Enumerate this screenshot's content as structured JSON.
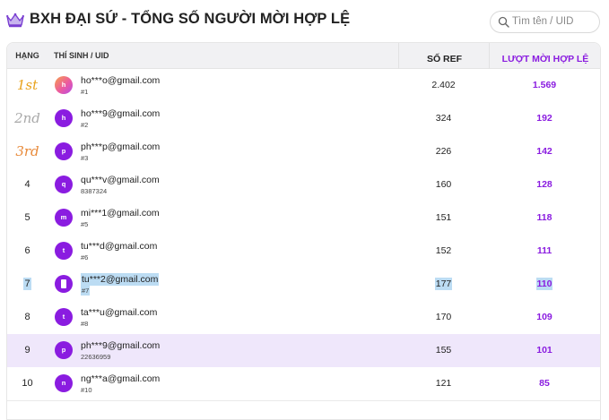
{
  "header": {
    "title": "BXH ĐẠI SỨ - TỔNG SỐ NGƯỜI MỜI HỢP LỆ",
    "icon": "crown-icon"
  },
  "search": {
    "placeholder": "Tìm tên / UID",
    "value": ""
  },
  "table": {
    "columns": {
      "rank": "HẠNG",
      "user": "THÍ SINH / UID",
      "ref": "SỐ REF",
      "valid": "LƯỢT MỜI HỢP LỆ"
    },
    "rows": [
      {
        "rank": "1st",
        "avatar": "h",
        "email": "ho***o@gmail.com",
        "uid": "#1",
        "ref": "2.402",
        "valid": "1.569"
      },
      {
        "rank": "2nd",
        "avatar": "h",
        "email": "ho***9@gmail.com",
        "uid": "#2",
        "ref": "324",
        "valid": "192"
      },
      {
        "rank": "3rd",
        "avatar": "p",
        "email": "ph***p@gmail.com",
        "uid": "#3",
        "ref": "226",
        "valid": "142"
      },
      {
        "rank": "4",
        "avatar": "q",
        "email": "qu***v@gmail.com",
        "uid": "8387324",
        "ref": "160",
        "valid": "128"
      },
      {
        "rank": "5",
        "avatar": "m",
        "email": "mi***1@gmail.com",
        "uid": "#5",
        "ref": "151",
        "valid": "118"
      },
      {
        "rank": "6",
        "avatar": "t",
        "email": "tu***d@gmail.com",
        "uid": "#6",
        "ref": "152",
        "valid": "111"
      },
      {
        "rank": "7",
        "avatar": "",
        "email": "tu***2@gmail.com",
        "uid": "#7",
        "ref": "177",
        "valid": "110"
      },
      {
        "rank": "8",
        "avatar": "t",
        "email": "ta***u@gmail.com",
        "uid": "#8",
        "ref": "170",
        "valid": "109"
      },
      {
        "rank": "9",
        "avatar": "p",
        "email": "ph***9@gmail.com",
        "uid": "22636959",
        "ref": "155",
        "valid": "101"
      },
      {
        "rank": "10",
        "avatar": "n",
        "email": "ng***a@gmail.com",
        "uid": "#10",
        "ref": "121",
        "valid": "85"
      }
    ]
  },
  "colors": {
    "accent": "#8a1ce0",
    "highlight_row": "#efe7fb",
    "text_selection": "#bcdcf3",
    "gold": "#e8a21c",
    "silver": "#a9a9a9",
    "bronze": "#e88a3a"
  }
}
